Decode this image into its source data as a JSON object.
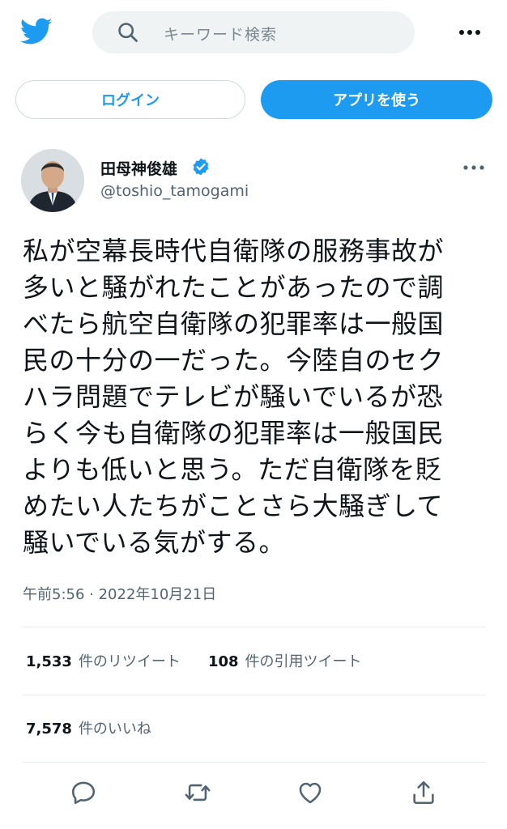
{
  "header": {
    "search_placeholder": "キーワード検索",
    "login_label": "ログイン",
    "app_label": "アプリを使う"
  },
  "tweet": {
    "author_name": "田母神俊雄",
    "author_handle": "@toshio_tamogami",
    "verified": true,
    "lines": [
      "私が空幕長時代自衛隊の服務事故が",
      "多いと騒がれたことがあったので調",
      "べたら航空自衛隊の犯罪率は一般国",
      "民の十分の一だった。今陸自のセク",
      "ハラ問題でテレビが騒いでいるが恐",
      "らく今も自衛隊の犯罪率は一般国民",
      "よりも低いと思う。ただ自衛隊を貶",
      "めたい人たちがことさら大騒ぎして",
      "騒いでいる気がする。"
    ],
    "timestamp": "午前5:56 · 2022年10月21日"
  },
  "stats": {
    "retweets_count": "1,533",
    "retweets_label": "件のリツイート",
    "quotes_count": "108",
    "quotes_label": "件の引用ツイート",
    "likes_count": "7,578",
    "likes_label": "件のいいね"
  },
  "colors": {
    "accent": "#1d9bf0",
    "secondary_text": "#536471",
    "divider": "#e6ecf0"
  },
  "icons": [
    "twitter-logo-icon",
    "search-icon",
    "more-icon",
    "verified-badge-icon",
    "reply-icon",
    "retweet-icon",
    "like-icon",
    "share-icon"
  ]
}
